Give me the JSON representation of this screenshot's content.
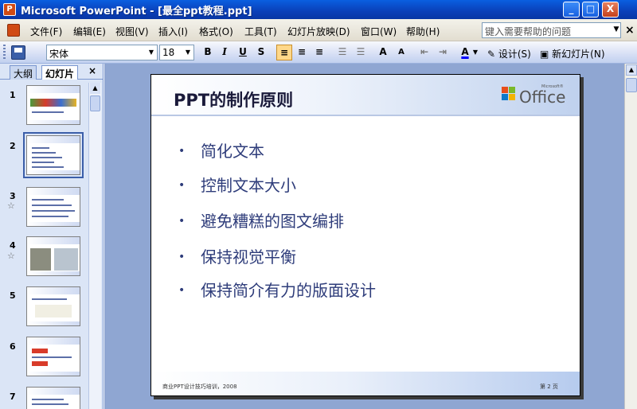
{
  "window": {
    "title": "Microsoft PowerPoint - [最全ppt教程.ppt]",
    "min_glyph": "_",
    "max_glyph": "□",
    "close_glyph": "X"
  },
  "menu": {
    "items": [
      "文件(F)",
      "编辑(E)",
      "视图(V)",
      "插入(I)",
      "格式(O)",
      "工具(T)",
      "幻灯片放映(D)",
      "窗口(W)",
      "帮助(H)"
    ],
    "help_placeholder": "键入需要帮助的问题",
    "close_glyph": "×"
  },
  "toolbar": {
    "font": "宋体",
    "size": "18",
    "bold": "B",
    "italic": "I",
    "underline": "U",
    "shadow": "S",
    "design_label": "设计(S)",
    "new_slide_label": "新幻灯片(N)"
  },
  "left_pane": {
    "tab_outline": "大纲",
    "tab_slides": "幻灯片",
    "close_glyph": "×",
    "slide_numbers": [
      "1",
      "2",
      "3",
      "4",
      "5",
      "6",
      "7"
    ],
    "selected_slide": 2
  },
  "slide": {
    "title": "PPT的制作原则",
    "logo_text": "Office",
    "logo_small": "Microsoft®",
    "logo_colors": [
      "#e84e1b",
      "#7ab929",
      "#0f7ac8",
      "#f3b300"
    ],
    "bullets": [
      "简化文本",
      "控制文本大小",
      "避免糟糕的图文编排",
      "保持视觉平衡",
      "保持简介有力的版面设计"
    ],
    "footer_left": "商业PPT设计技巧培训，2008",
    "footer_right": "第 2 页"
  }
}
